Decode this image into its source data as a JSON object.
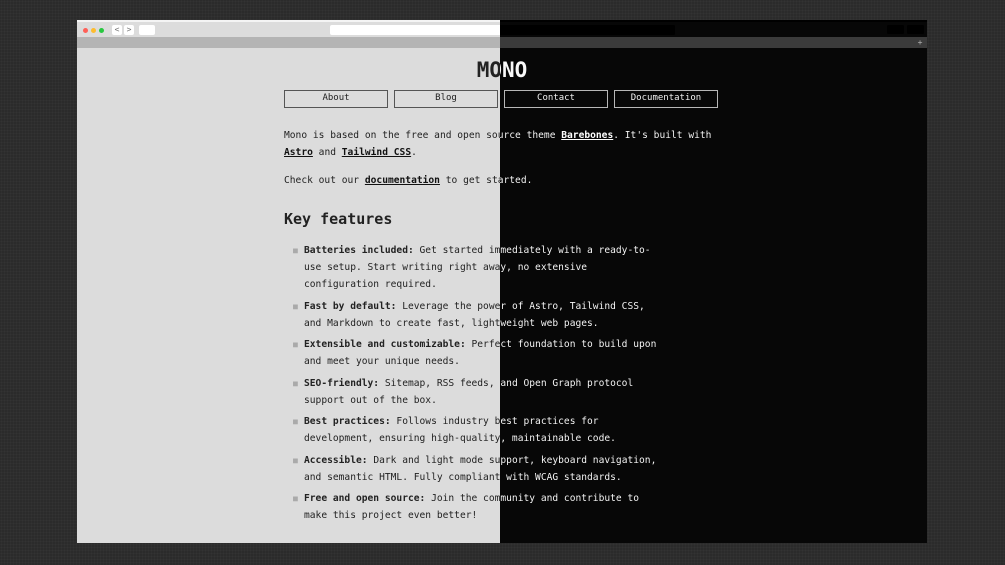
{
  "browser": {
    "back": "<",
    "forward": ">",
    "new_tab": "+"
  },
  "site": {
    "logo": "MONO",
    "nav": [
      "About",
      "Blog",
      "Contact",
      "Documentation"
    ],
    "intro": {
      "t1": "Mono is based on the free and open source theme ",
      "l1": "Barebones",
      "t2": ". It's built with ",
      "l2": "Astro",
      "t3": " and ",
      "l3": "Tailwind CSS",
      "t4": "."
    },
    "cta": {
      "t1": "Check out our ",
      "l1": "documentation",
      "t2": " to get started."
    },
    "features_heading": "Key features",
    "features": [
      {
        "title": "Batteries included:",
        "text": " Get started immediately with a ready-to-use setup. Start writing right away, no extensive configuration required."
      },
      {
        "title": "Fast by default:",
        "text": " Leverage the power of Astro, Tailwind CSS, and Markdown to create fast, lightweight web pages."
      },
      {
        "title": "Extensible and customizable:",
        "text": " Perfect foundation to build upon and meet your unique needs."
      },
      {
        "title": "SEO-friendly:",
        "text": " Sitemap, RSS feeds, and Open Graph protocol support out of the box."
      },
      {
        "title": "Best practices:",
        "text": " Follows industry best practices for development, ensuring high-quality, maintainable code."
      },
      {
        "title": "Accessible:",
        "text": " Dark and light mode support, keyboard navigation, and semantic HTML. Fully compliant with WCAG standards."
      },
      {
        "title": "Free and open source:",
        "text": " Join the community and contribute to make this project even better!"
      }
    ]
  },
  "colors": {
    "close": "#ff5f57",
    "minimize": "#febc2e",
    "maximize": "#28c840"
  }
}
